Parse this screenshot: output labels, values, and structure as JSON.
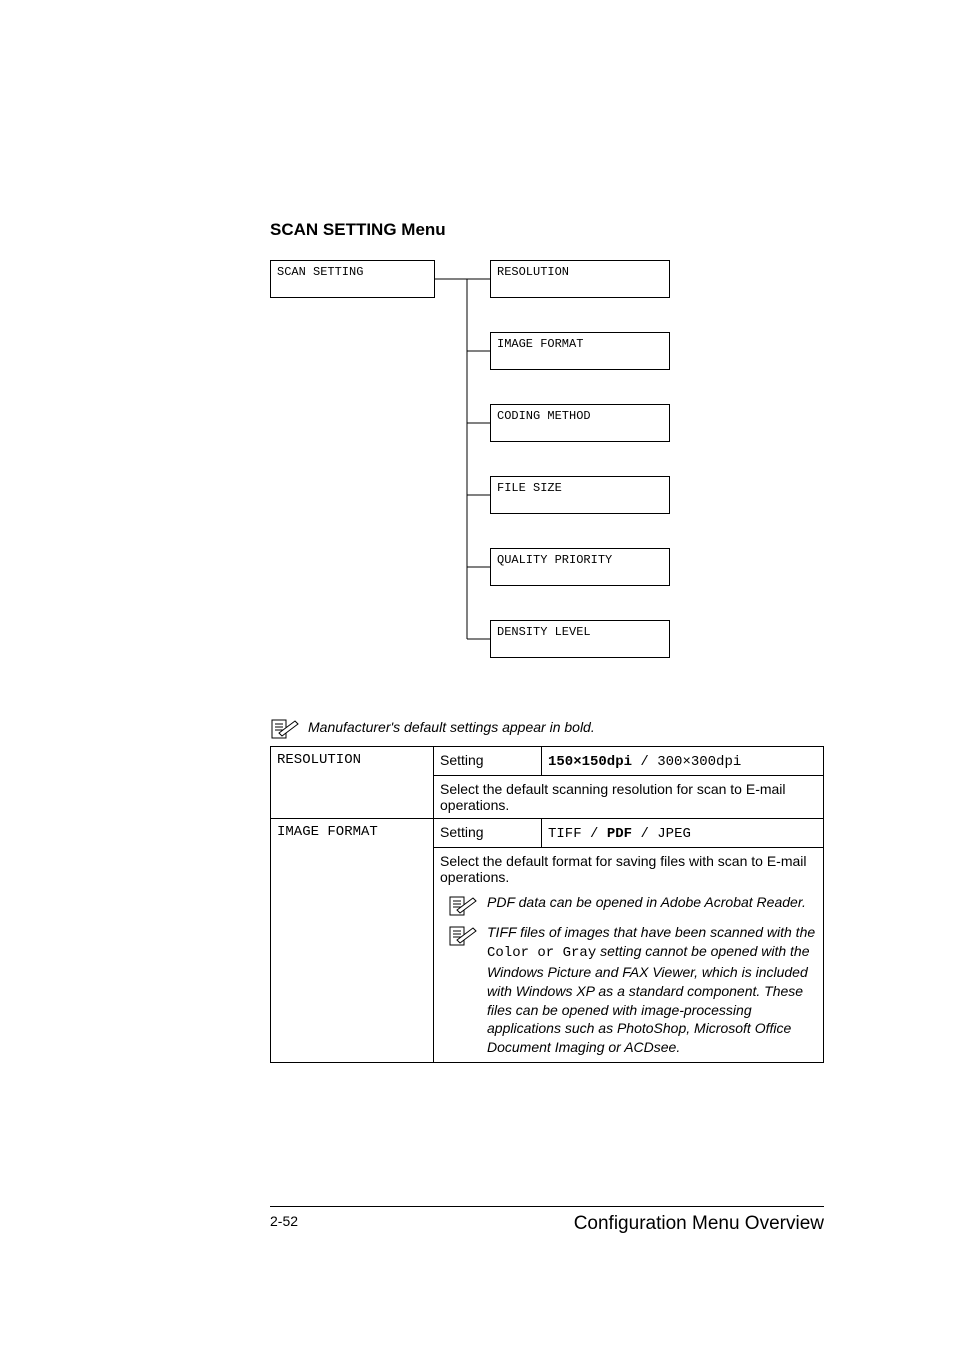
{
  "heading": "SCAN SETTING Menu",
  "tree": {
    "root": "SCAN SETTING",
    "children": [
      "RESOLUTION",
      "IMAGE FORMAT",
      "CODING METHOD",
      "FILE SIZE",
      "QUALITY PRIORITY",
      "DENSITY LEVEL"
    ]
  },
  "main_note": "Manufacturer's default settings appear in bold.",
  "table": {
    "setting_label": "Setting",
    "row1_name": "RESOLUTION",
    "row1_opt_bold": "150×150dpi",
    "row1_sep1": " / ",
    "row1_opt_plain": "300×300dpi",
    "row1_desc": "Select the default scanning resolution for scan to E-mail operations.",
    "row2_name": "IMAGE FORMAT",
    "row2_opt_a": "TIFF",
    "row2_sepA": " / ",
    "row2_opt_b": "PDF",
    "row2_sepB": " / ",
    "row2_opt_c": "JPEG",
    "row2_desc": "Select the default format for saving files with scan to E-mail operations.",
    "row2_note1": "PDF data can be opened in Adobe Acrobat Reader.",
    "row2_note2_pre": "TIFF files of images that have been scanned with the ",
    "row2_note2_mono": "Color or Gray",
    "row2_note2_post": " setting cannot be opened with the Windows Picture and FAX Viewer, which is included with Windows XP as a standard component. These files can be opened with image-processing applications such as PhotoShop, Microsoft Office Document Imaging or ACDsee."
  },
  "footer": {
    "pagenum": "2-52",
    "title": "Configuration Menu Overview"
  }
}
